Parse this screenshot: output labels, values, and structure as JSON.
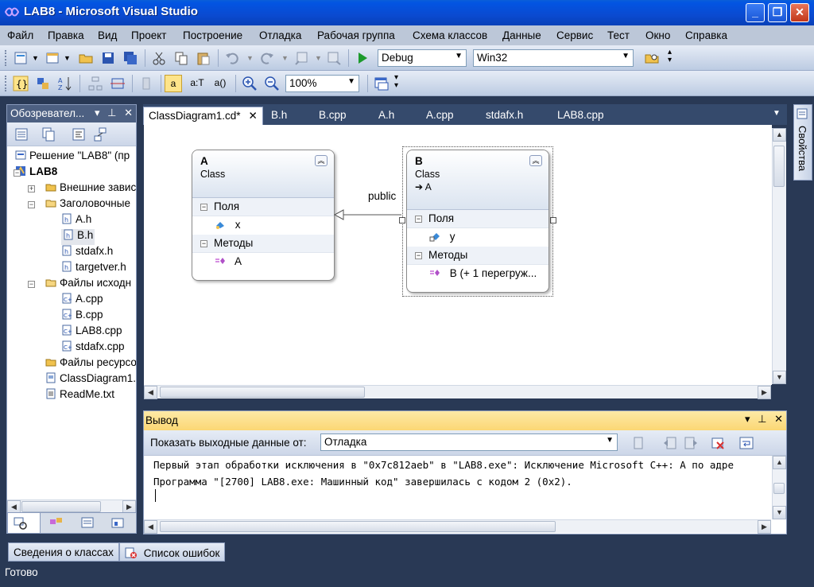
{
  "window": {
    "title": "LAB8 - Microsoft Visual Studio",
    "min_label": "_",
    "max_label": "❐",
    "close_label": "✕"
  },
  "menu": {
    "items": [
      "Файл",
      "Правка",
      "Вид",
      "Проект",
      "Построение",
      "Отладка",
      "Рабочая группа",
      "Схема классов",
      "Данные",
      "Сервис",
      "Тест",
      "Окно",
      "Справка"
    ]
  },
  "toolbar": {
    "config_value": "Debug",
    "platform_value": "Win32",
    "zoom_value": "100%",
    "btn_a_label": "a",
    "btn_at_label": "a:T",
    "btn_aparen_label": "a()"
  },
  "solution_explorer": {
    "title": "Обозревател...",
    "tree": [
      {
        "label": "Решение \"LAB8\" (пр",
        "indent": 0,
        "icon": "solution-icon",
        "expander": ""
      },
      {
        "label": "LAB8",
        "indent": 0,
        "icon": "project-icon",
        "expander": "-",
        "bold": true
      },
      {
        "label": "Внешние завис",
        "indent": 1,
        "icon": "folder-icon",
        "expander": "+"
      },
      {
        "label": "Заголовочные",
        "indent": 1,
        "icon": "folder-open-icon",
        "expander": "-"
      },
      {
        "label": "A.h",
        "indent": 2,
        "icon": "header-file-icon",
        "expander": ""
      },
      {
        "label": "B.h",
        "indent": 2,
        "icon": "header-file-icon",
        "expander": "",
        "selected": true
      },
      {
        "label": "stdafx.h",
        "indent": 2,
        "icon": "header-file-icon",
        "expander": ""
      },
      {
        "label": "targetver.h",
        "indent": 2,
        "icon": "header-file-icon",
        "expander": ""
      },
      {
        "label": "Файлы исходн",
        "indent": 1,
        "icon": "folder-open-icon",
        "expander": "-"
      },
      {
        "label": "A.cpp",
        "indent": 2,
        "icon": "cpp-file-icon",
        "expander": ""
      },
      {
        "label": "B.cpp",
        "indent": 2,
        "icon": "cpp-file-icon",
        "expander": ""
      },
      {
        "label": "LAB8.cpp",
        "indent": 2,
        "icon": "cpp-file-icon",
        "expander": ""
      },
      {
        "label": "stdafx.cpp",
        "indent": 2,
        "icon": "cpp-file-icon",
        "expander": ""
      },
      {
        "label": "Файлы ресурсо",
        "indent": 1,
        "icon": "folder-icon",
        "expander": ""
      },
      {
        "label": "ClassDiagram1.",
        "indent": 1,
        "icon": "class-diagram-icon",
        "expander": ""
      },
      {
        "label": "ReadMe.txt",
        "indent": 1,
        "icon": "text-file-icon",
        "expander": ""
      }
    ]
  },
  "doc_tabs": [
    {
      "label": "ClassDiagram1.cd*",
      "active": true
    },
    {
      "label": "B.h",
      "active": false
    },
    {
      "label": "B.cpp",
      "active": false
    },
    {
      "label": "A.h",
      "active": false
    },
    {
      "label": "A.cpp",
      "active": false
    },
    {
      "label": "stdafx.h",
      "active": false
    },
    {
      "label": "LAB8.cpp",
      "active": false
    }
  ],
  "diagram": {
    "class_a": {
      "name": "A",
      "kind": "Class",
      "fields_label": "Поля",
      "field": "x",
      "methods_label": "Методы",
      "method": "A"
    },
    "class_b": {
      "name": "B",
      "kind": "Class",
      "inherits": "➔ A",
      "fields_label": "Поля",
      "field": "y",
      "methods_label": "Методы",
      "method": "B (+ 1 перегруж..."
    },
    "inheritance_label": "public"
  },
  "properties_tab": {
    "label": "Свойства"
  },
  "output": {
    "title": "Вывод",
    "source_label": "Показать выходные данные от:",
    "source_value": "Отладка",
    "lines": [
      "Первый этап обработки исключения в \"0x7c812aeb\" в \"LAB8.exe\": Исключение Microsoft C++: A по адре",
      "Программа \"[2700] LAB8.exe: Машинный код\" завершилась с кодом 2 (0x2)."
    ]
  },
  "bottom_tabs": {
    "class_details": "Сведения о классах",
    "error_list": "Список ошибок"
  },
  "status": {
    "text": "Готово"
  },
  "colors": {
    "titlebar": "#0a4ad0",
    "chrome": "#293955",
    "output_header": "#fbd774"
  }
}
